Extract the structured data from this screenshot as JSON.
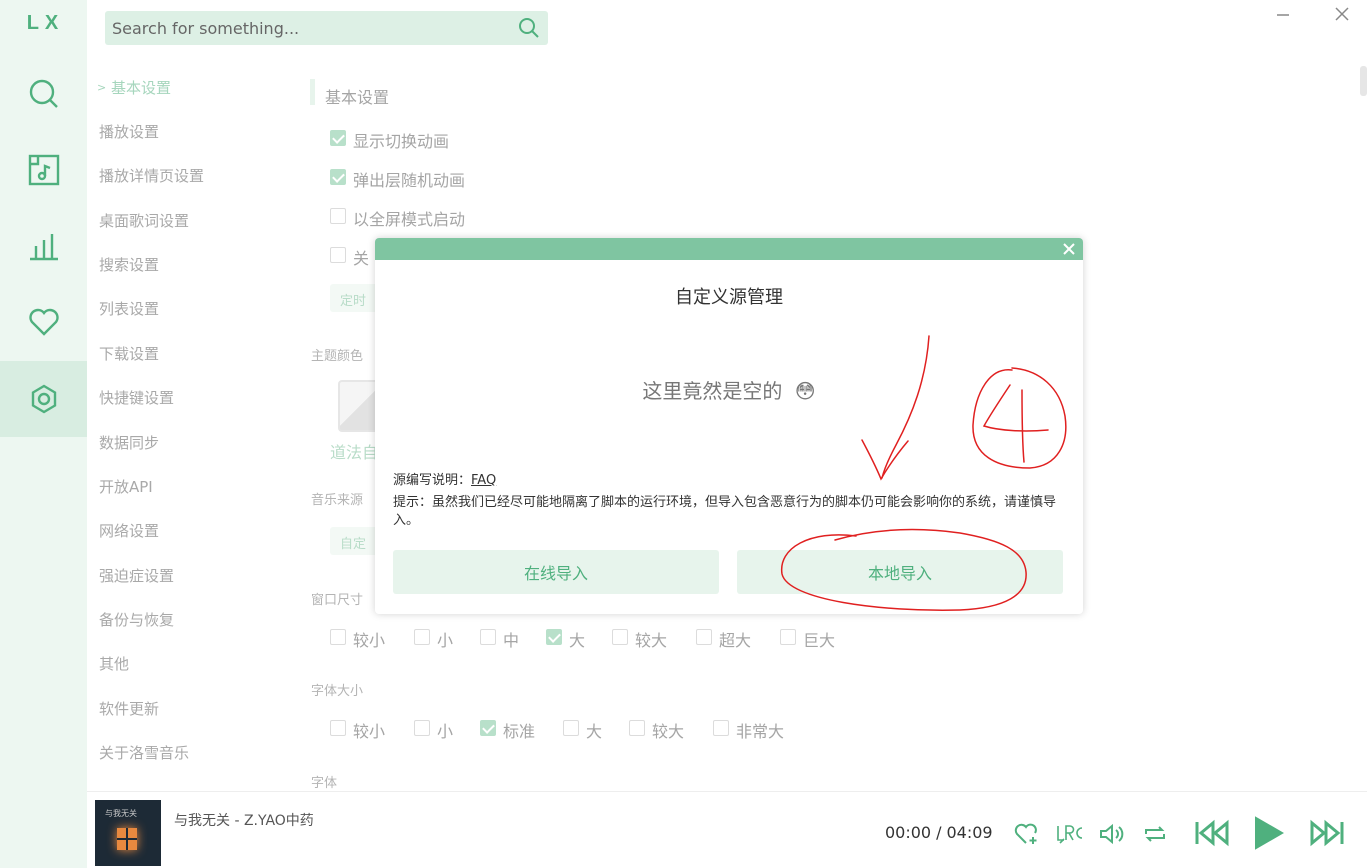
{
  "app": {
    "logo": "LX"
  },
  "search": {
    "placeholder": "Search for something..."
  },
  "rail": [
    "search-icon",
    "music-library-icon",
    "chart-icon",
    "heart-icon",
    "settings-icon"
  ],
  "menu": {
    "items": [
      "基本设置",
      "播放设置",
      "播放详情页设置",
      "桌面歌词设置",
      "搜索设置",
      "列表设置",
      "下载设置",
      "快捷键设置",
      "数据同步",
      "开放API",
      "网络设置",
      "强迫症设置",
      "备份与恢复",
      "其他",
      "软件更新",
      "关于洛雪音乐"
    ]
  },
  "content": {
    "section_title": "基本设置",
    "checks": [
      {
        "label": "显示切换动画",
        "checked": true
      },
      {
        "label": "弹出层随机动画",
        "checked": true
      },
      {
        "label": "以全屏模式启动",
        "checked": false
      },
      {
        "label": "关",
        "checked": false
      }
    ],
    "chip_timer": "定时",
    "theme_label": "主题颜色",
    "theme_caption": "道法自",
    "source_label": "音乐来源",
    "source_chip": "自定",
    "window_size": {
      "label": "窗口尺寸",
      "options": [
        {
          "label": "较小",
          "checked": false
        },
        {
          "label": "小",
          "checked": false
        },
        {
          "label": "中",
          "checked": false
        },
        {
          "label": "大",
          "checked": true
        },
        {
          "label": "较大",
          "checked": false
        },
        {
          "label": "超大",
          "checked": false
        },
        {
          "label": "巨大",
          "checked": false
        }
      ]
    },
    "font_size": {
      "label": "字体大小",
      "options": [
        {
          "label": "较小",
          "checked": false
        },
        {
          "label": "小",
          "checked": false
        },
        {
          "label": "标准",
          "checked": true
        },
        {
          "label": "大",
          "checked": false
        },
        {
          "label": "较大",
          "checked": false
        },
        {
          "label": "非常大",
          "checked": false
        }
      ]
    },
    "font_label": "字体"
  },
  "modal": {
    "title": "自定义源管理",
    "empty_text": "这里竟然是空的",
    "empty_emoji": "😳",
    "faq_prefix": "源编写说明：",
    "faq_link": "FAQ",
    "tip": "提示：虽然我们已经尽可能地隔离了脚本的运行环境，但导入包含恶意行为的脚本仍可能会影响你的系统，请谨慎导入。",
    "online_import": "在线导入",
    "local_import": "本地导入"
  },
  "player": {
    "song": "与我无关 - Z.YAO中药",
    "current_time": "00:00",
    "separator": "/",
    "total_time": "04:09",
    "cover_text": "与我无关",
    "controls": [
      "heart-add-icon",
      "lyrics-icon",
      "volume-icon",
      "repeat-icon",
      "previous-icon",
      "play-icon",
      "next-icon"
    ]
  },
  "colors": {
    "accent": "#4fb07e",
    "modal_header": "#7fc5a1",
    "annotation": "#e02020"
  }
}
